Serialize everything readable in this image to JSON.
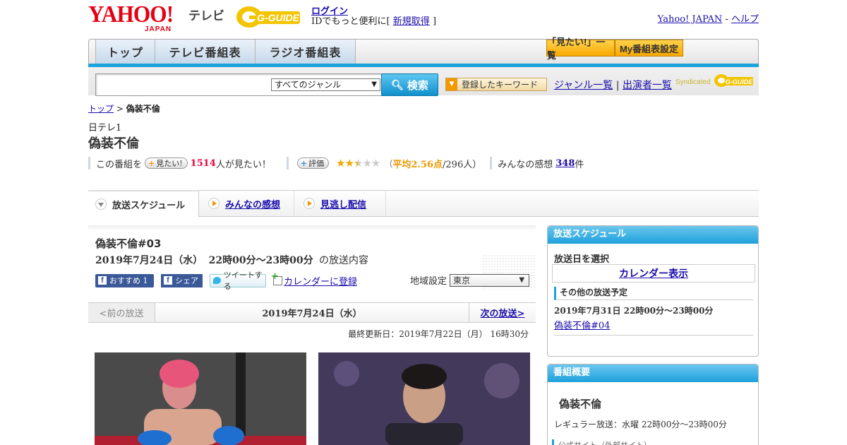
{
  "header": {
    "logo_yahoo": "YAHOO!",
    "logo_japan": "JAPAN",
    "logo_tv": "テレビ",
    "logo_gguide": "G-GUIDE",
    "login": "ログイン",
    "login_sub_prefix": "IDでもっと便利に[",
    "register": "新規取得",
    "login_sub_suffix": "]",
    "yahoo_japan": "Yahoo! JAPAN",
    "dash": "-",
    "help": "ヘルプ"
  },
  "nav": {
    "tabs": [
      "トップ",
      "テレビ番組表",
      "ラジオ番組表"
    ],
    "want_list": "「見たい!」一覧",
    "my_schedule": "My番組表設定"
  },
  "search": {
    "placeholder": "",
    "genre_select": "すべてのジャンル",
    "button": "検索",
    "keyword_button": "登録したキーワード",
    "genre_list": "ジャンル一覧",
    "pipe": "|",
    "cast_list": "出演者一覧",
    "syndicated": "Syndicated"
  },
  "breadcrumb": {
    "top": "トップ",
    "sep": ">",
    "current": "偽装不倫"
  },
  "program": {
    "channel": "日テレ1",
    "title": "偽装不倫",
    "want_prefix": "この番組を",
    "want_btn": "見たい!",
    "want_count": "1514",
    "want_suffix": "人が見たい！",
    "rate_btn": "評価",
    "rating_stars": 2.5,
    "avg_label_open": "（",
    "avg_label": "平均2.56点",
    "avg_count": "/296人）",
    "impressions_label": "みんなの感想",
    "impressions_count": "348",
    "impressions_suffix": "件"
  },
  "tabs": {
    "schedule": "放送スケジュール",
    "impressions": "みんなの感想",
    "missed": "見逃し配信"
  },
  "episode": {
    "title": "偽装不倫#03",
    "date": "2019年7月24日（水）",
    "time": "22時00分～23時00分",
    "suffix": "の放送内容",
    "fb_like": "おすすめ 1",
    "fb_share": "シェア",
    "tweet": "ツイートする",
    "calendar": "カレンダーに登録",
    "region_label": "地域設定",
    "region_value": "東京"
  },
  "datenav": {
    "prev": "<前の放送",
    "current": "2019年7月24日（水）",
    "next": "次の放送>"
  },
  "updated": "最終更新日：2019年7月22日（月） 16時30分",
  "sidebar": {
    "schedule_header": "放送スケジュール",
    "select_date": "放送日を選択",
    "calendar_display": "カレンダー表示",
    "other_label": "その他の放送予定",
    "other_date": "2019年7月31日 22時00分～23時00分",
    "other_link": "偽装不倫#04",
    "overview_header": "番組概要",
    "overview_title": "偽装不倫",
    "regular": "レギュラー放送：水曜 22時00分～23時00分",
    "official_site": "公式サイト（外部サイト）"
  }
}
